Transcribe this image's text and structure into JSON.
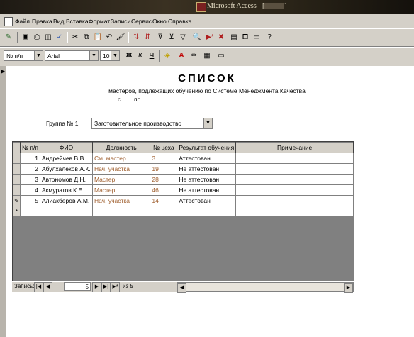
{
  "window": {
    "title": "Microsoft Access - ["
  },
  "menu": [
    "Файл",
    "Правка",
    "Вид",
    "Вставка",
    "Формат",
    "Записи",
    "Сервис",
    "Окно",
    "Справка"
  ],
  "format_toolbar": {
    "field_combo": "№ п/п",
    "font_combo": "Arial",
    "size_combo": "10",
    "bold": "Ж",
    "italic": "К",
    "underline": "Ч"
  },
  "form": {
    "title": "СПИСОК",
    "subtitle": "мастеров, подлежащих обучению по Системе Менеджмента Качества",
    "date_from": "с",
    "date_to": "по",
    "group_label": "Группа № 1",
    "group_value": "Заготовительное производство"
  },
  "table": {
    "headers": [
      "№ п/п",
      "ФИО",
      "Должность",
      "№ цеха",
      "Результат обучения",
      "Примечание"
    ],
    "rows": [
      {
        "num": "1",
        "name": "Андрейчев В.В.",
        "position": "См. мастер",
        "shop": "3",
        "result": "Аттестован",
        "note": ""
      },
      {
        "num": "2",
        "name": "Абулхалеков А.К.",
        "position": "Нач. участка",
        "shop": "19",
        "result": "Не аттестован",
        "note": ""
      },
      {
        "num": "3",
        "name": "Автономов Д.Н.",
        "position": "Мастер",
        "shop": "28",
        "result": "Не аттестован",
        "note": ""
      },
      {
        "num": "4",
        "name": "Акмуратов К.Е.",
        "position": "Мастер",
        "shop": "46",
        "result": "Не аттестован",
        "note": ""
      },
      {
        "num": "5",
        "name": "Алиакберов А.М.",
        "position": "Нач. участка",
        "shop": "14",
        "result": "Аттестован",
        "note": ""
      }
    ]
  },
  "navigation": {
    "label": "Запись:",
    "current": "5",
    "of_label": "из 5"
  },
  "colors": {
    "brown_text": "#a06030"
  }
}
